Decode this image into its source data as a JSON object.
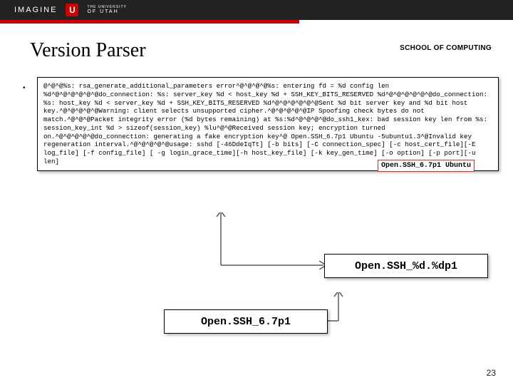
{
  "header": {
    "imagine": "IMAGINE",
    "logo_letter": "U",
    "university_top": "THE UNIVERSITY",
    "university_bot": "OF UTAH",
    "school": "SCHOOL OF COMPUTING"
  },
  "title": "Version Parser",
  "code_block": "@^@^@%s: rsa_generate_additional_parameters error^@^@^@^@%s: entering fd = %d config len %d^@^@^@^@^@^@do_connection: %s: server_key %d < host_key %d + SSH_KEY_BITS_RESERVED %d^@^@^@^@^@^@do_connection: %s: host_key %d < server_key %d + SSH_KEY_BITS_RESERVED %d^@^@^@^@^@^@Sent %d bit server key and %d bit host key.^@^@^@^@^@Warning: client selects unsupported cipher.^@^@^@^@^@IP Spoofing check bytes do not match.^@^@^@Packet integrity error (%d bytes remaining) at %s:%d^@^@^@^@do_ssh1_kex: bad session key len from %s: session_key_int %d > sizeof(session_key) %lu^@^@Received session key; encryption turned on.^@^@^@^@^@do_connection: generating a fake encryption key^@ Open.SSH_6.7p1 Ubuntu -5ubuntu1.3^@Invalid key regeneration interval.^@^@^@^@^@usage: sshd [-46DdeIqTt] [-b bits] [-C connection_spec] [-c host_cert_file][-E log_file] [-f config_file] [ -g login_grace_time][-h host_key_file] [-k key_gen_time] [-o option] [-p port][-u len]",
  "inline_chip": "Open.SSH_6.7p1 Ubuntu",
  "format_box": "Open.SSH_%d.%dp1",
  "result_box": "Open.SSH_6.7p1",
  "page_number": "23"
}
